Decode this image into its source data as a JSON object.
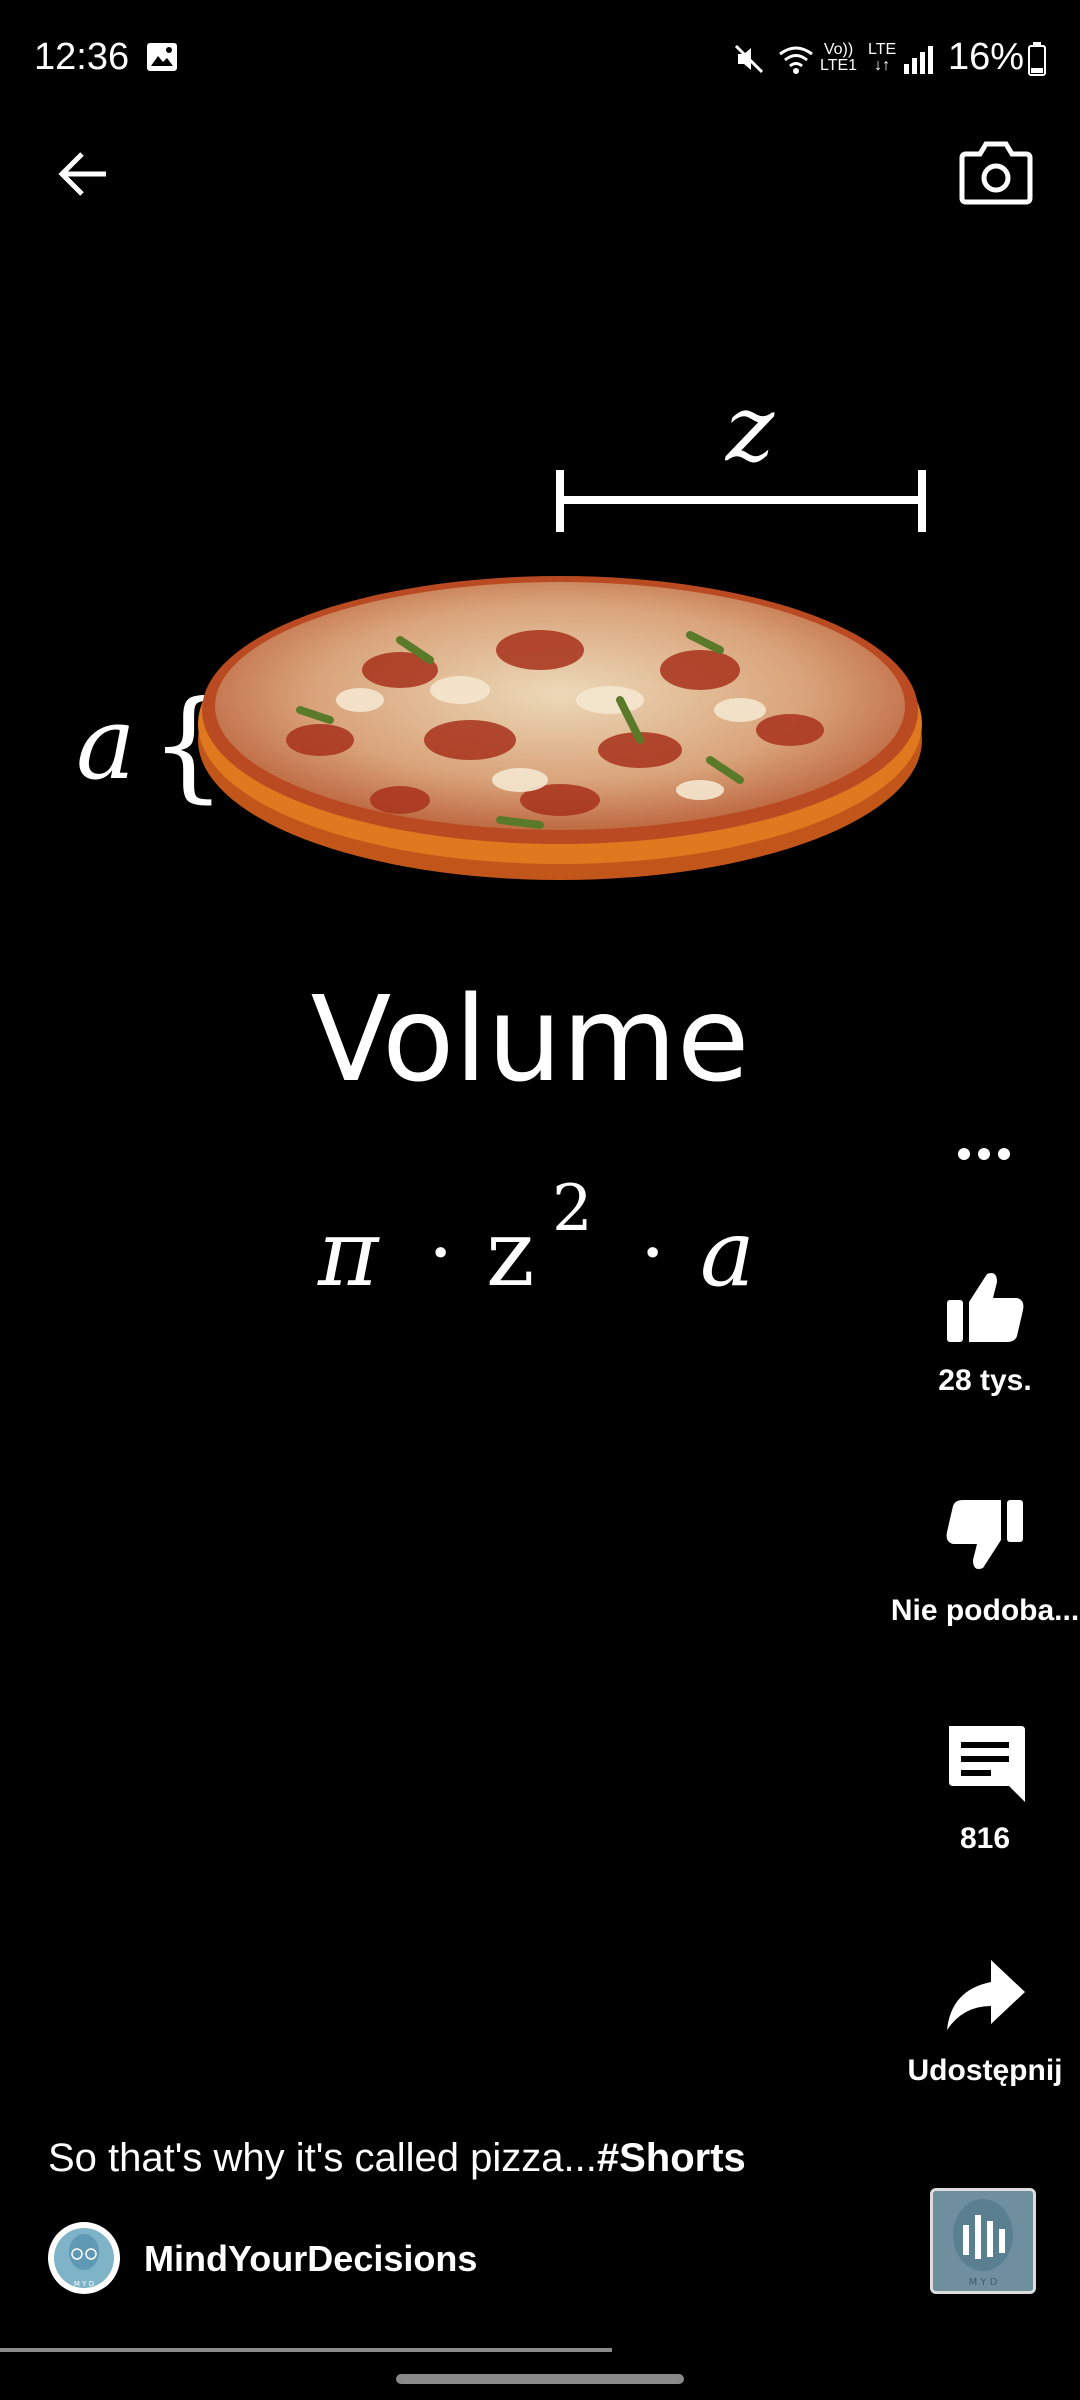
{
  "status_bar": {
    "time": "12:36",
    "volte_top": "Vo))",
    "volte_bottom": "LTE1",
    "lte_label": "LTE",
    "battery": "16%"
  },
  "video": {
    "dimension_top": "z",
    "dimension_left": "a",
    "volume_title": "Volume",
    "formula": {
      "pi": "π",
      "dot": "·",
      "z": "z",
      "exp": "2",
      "a": "a"
    }
  },
  "actions": {
    "like_count": "28 tys.",
    "dislike_label": "Nie podoba...",
    "comments_count": "816",
    "share_label": "Udostępnij"
  },
  "caption": {
    "text": "So that's why it's called pizza...",
    "hashtag": "#Shorts"
  },
  "channel": {
    "name": "MindYourDecisions",
    "avatar_text": "M Y D"
  },
  "colors": {
    "background": "#000000",
    "foreground": "#ffffff",
    "progress": "#8a8a8a",
    "pizza_crust": "#d86b1c",
    "pizza_sauce": "#b84a2a",
    "pizza_cheese": "#e8d3b0"
  }
}
